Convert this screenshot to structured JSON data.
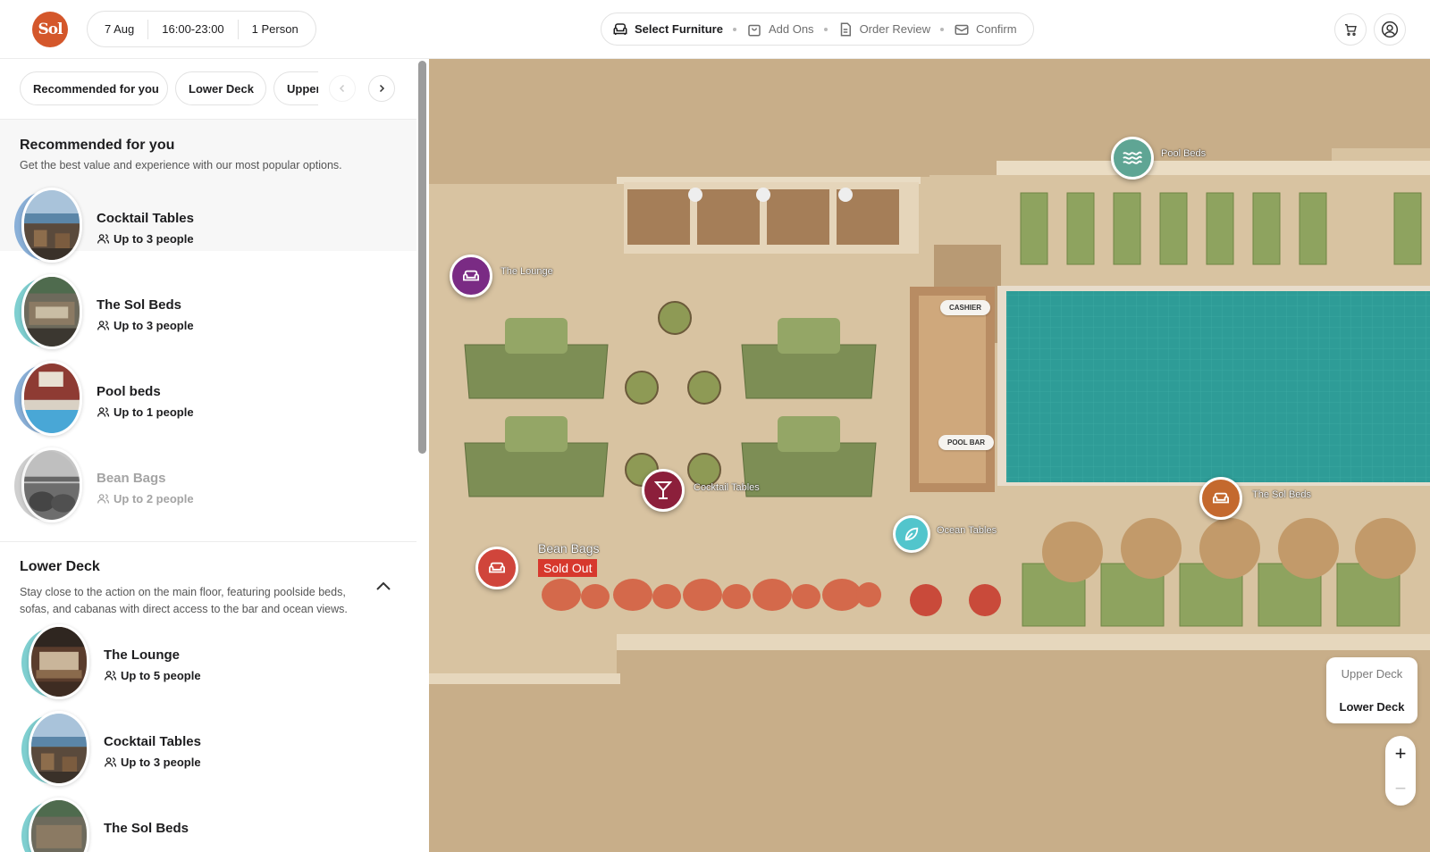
{
  "header": {
    "logo_text": "Sol",
    "booking": {
      "date": "7 Aug",
      "time": "16:00-23:00",
      "guests": "1 Person"
    },
    "steps": [
      {
        "label": "Select Furniture",
        "icon": "sofa-icon"
      },
      {
        "label": "Add Ons",
        "icon": "bag-icon"
      },
      {
        "label": "Order Review",
        "icon": "document-icon"
      },
      {
        "label": "Confirm",
        "icon": "ticket-icon"
      }
    ],
    "cart_icon": "cart-icon",
    "account_icon": "user-icon"
  },
  "sidebar": {
    "filters": [
      "Recommended for you",
      "Lower Deck",
      "Upper Deck"
    ],
    "recommended": {
      "title": "Recommended for you",
      "description": "Get the best value and experience with our most popular options.",
      "items": [
        {
          "name": "Cocktail Tables",
          "capacity": "Up to 3 people",
          "available": true
        },
        {
          "name": "The Sol Beds",
          "capacity": "Up to 3 people",
          "available": true
        },
        {
          "name": "Pool beds",
          "capacity": "Up to 1 people",
          "available": true
        },
        {
          "name": "Bean Bags",
          "capacity": "Up to 2 people",
          "available": false
        }
      ]
    },
    "lower_deck": {
      "title": "Lower Deck",
      "description": "Stay close to the action on the main floor, featuring poolside beds, sofas, and cabanas with direct access to the bar and ocean views.",
      "items": [
        {
          "name": "The Lounge",
          "capacity": "Up to 5 people"
        },
        {
          "name": "Cocktail Tables",
          "capacity": "Up to 3 people"
        },
        {
          "name": "The Sol Beds",
          "capacity": ""
        }
      ]
    }
  },
  "map": {
    "pins": {
      "pool_beds": "Pool Beds",
      "lounge": "The Lounge",
      "cocktail": "Cocktail Tables",
      "sol_beds": "The Sol Beds",
      "ocean": "Ocean Tables",
      "bean_bags": "Bean Bags"
    },
    "sold_out": "Sold Out",
    "tags": {
      "cashier": "CASHIER",
      "pool_bar": "POOL BAR"
    },
    "deck_toggle": {
      "upper": "Upper Deck",
      "lower": "Lower Deck",
      "selected": "Lower Deck"
    },
    "zoom": {
      "in": "+",
      "out": "−"
    },
    "colors": {
      "lounge": "#7a2b84",
      "cocktail": "#8c1f3b",
      "sol_beds": "#c4692e",
      "ocean": "#52c5cc",
      "bean_bags": "#d0453b",
      "pool_beds": "#5fa594"
    }
  }
}
